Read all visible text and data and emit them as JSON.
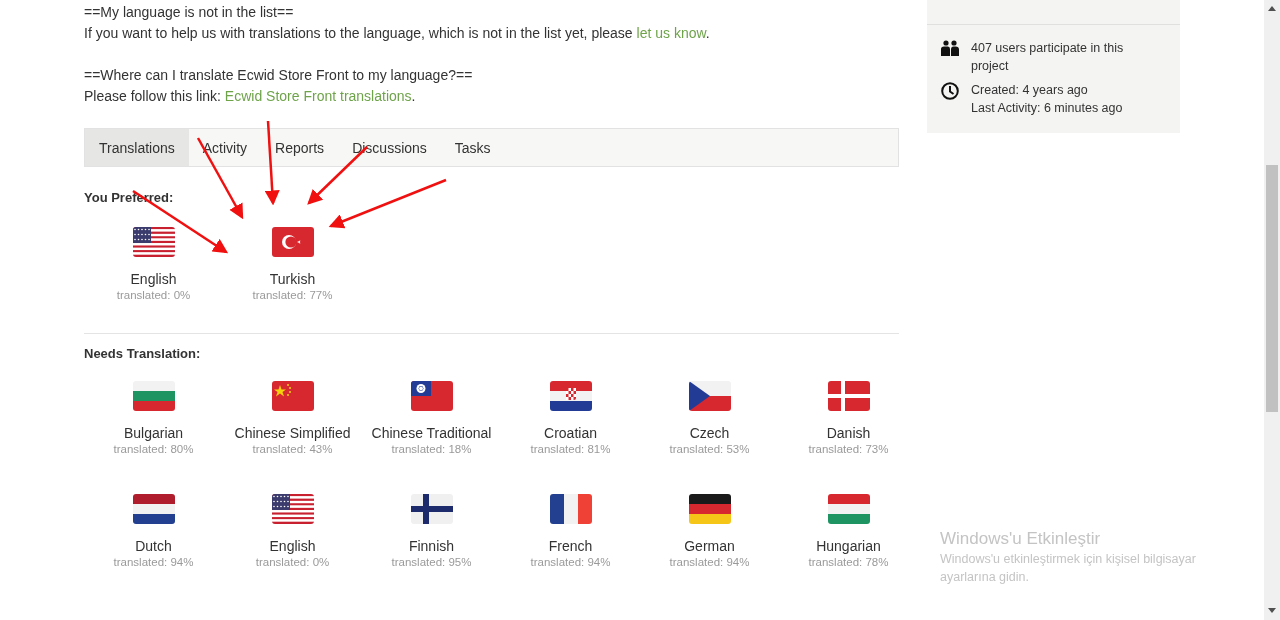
{
  "intro": [
    {
      "heading": "==My language is not in the list==",
      "text": "If you want to help us with translations to the language, which is not in the list yet, please ",
      "link": "let us know",
      "after": "."
    },
    {
      "heading": "==Where can I translate Ecwid Store Front to my language?==",
      "text": "Please follow this link: ",
      "link": "Ecwid Store Front translations",
      "after": "."
    }
  ],
  "tabs": [
    {
      "label": "Translations",
      "selected": true
    },
    {
      "label": "Activity",
      "selected": false
    },
    {
      "label": "Reports",
      "selected": false
    },
    {
      "label": "Discussions",
      "selected": false
    },
    {
      "label": "Tasks",
      "selected": false
    }
  ],
  "preferred": {
    "title": "You Preferred:",
    "languages": [
      {
        "name": "English",
        "caption": "translated: 0%",
        "kind": "us"
      },
      {
        "name": "Turkish",
        "caption": "translated: 77%",
        "kind": "tr"
      }
    ]
  },
  "needs": {
    "title": "Needs Translation:",
    "languages": [
      {
        "name": "Bulgarian",
        "caption": "translated: 80%",
        "kind": "bg"
      },
      {
        "name": "Chinese Simplified",
        "caption": "translated: 43%",
        "kind": "cn"
      },
      {
        "name": "Chinese Traditional",
        "caption": "translated: 18%",
        "kind": "tw"
      },
      {
        "name": "Croatian",
        "caption": "translated: 81%",
        "kind": "hr"
      },
      {
        "name": "Czech",
        "caption": "translated: 53%",
        "kind": "cz"
      },
      {
        "name": "Danish",
        "caption": "translated: 73%",
        "kind": "dk"
      },
      {
        "name": "Dutch",
        "caption": "translated: 94%",
        "kind": "nl"
      },
      {
        "name": "English",
        "caption": "translated: 0%",
        "kind": "us"
      },
      {
        "name": "Finnish",
        "caption": "translated: 95%",
        "kind": "fi"
      },
      {
        "name": "French",
        "caption": "translated: 94%",
        "kind": "fr"
      },
      {
        "name": "German",
        "caption": "translated: 94%",
        "kind": "de"
      },
      {
        "name": "Hungarian",
        "caption": "translated: 78%",
        "kind": "hu"
      }
    ]
  },
  "sidebar": {
    "items": [
      {
        "kind": "users",
        "lines": [
          "407 users participate in this project"
        ]
      },
      {
        "kind": "clock",
        "lines": [
          "Created: 4 years ago",
          "Last Activity: 6 minutes ago"
        ]
      }
    ]
  },
  "windows_notice": {
    "title": "Windows'u Etkinleştir",
    "text": "Windows'u etkinleştirmek için kişisel bilgisayar ayarlarına gidin."
  }
}
